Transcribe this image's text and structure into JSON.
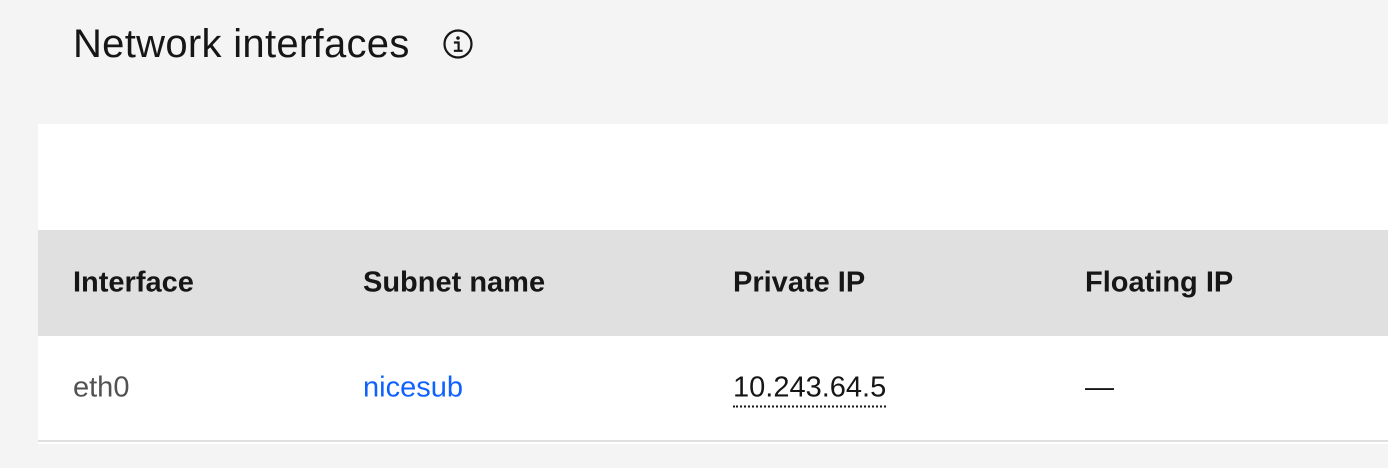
{
  "section": {
    "title": "Network interfaces",
    "info_icon": "information-icon"
  },
  "table": {
    "headers": {
      "interface": "Interface",
      "subnet_name": "Subnet name",
      "private_ip": "Private IP",
      "floating_ip": "Floating IP"
    },
    "rows": [
      {
        "interface": "eth0",
        "subnet_name": "nicesub",
        "private_ip": "10.243.64.5",
        "floating_ip": "—"
      }
    ]
  },
  "colors": {
    "page_bg": "#f4f4f4",
    "header_bg": "#e0e0e0",
    "link": "#0f62fe",
    "text": "#161616",
    "muted_text": "#525252"
  }
}
